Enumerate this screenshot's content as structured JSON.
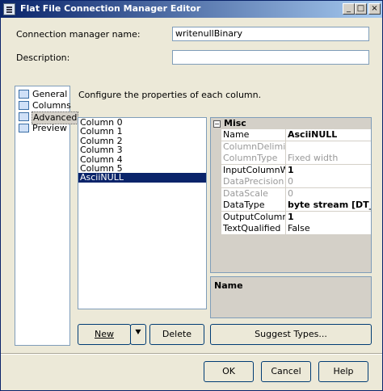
{
  "window": {
    "title": "Flat File Connection Manager Editor"
  },
  "form": {
    "name_label": "Connection manager name:",
    "name_value": "writenullBinary",
    "description_label": "Description:",
    "description_value": ""
  },
  "nav": {
    "items": [
      {
        "label": "General",
        "icon": "general-icon"
      },
      {
        "label": "Columns",
        "icon": "columns-icon"
      },
      {
        "label": "Advanced",
        "icon": "advanced-icon",
        "selected": true
      },
      {
        "label": "Preview",
        "icon": "preview-icon"
      }
    ]
  },
  "main": {
    "instruction": "Configure the properties of each column."
  },
  "columns": {
    "items": [
      "Column 0",
      "Column 1",
      "Column 2",
      "Column 3",
      "Column 4",
      "Column 5",
      "AsciiNULL"
    ],
    "selected": "AsciiNULL"
  },
  "properties": {
    "category": "Misc",
    "collapse_glyph": "−",
    "rows": [
      {
        "name": "Name",
        "value": "AsciiNULL",
        "enabled": true,
        "bold": true
      },
      {
        "name": "ColumnDelimiter",
        "value": "",
        "enabled": false
      },
      {
        "name": "ColumnType",
        "value": "Fixed width",
        "enabled": false
      },
      {
        "name": "InputColumnWidth",
        "value": "1",
        "enabled": true,
        "bold": true
      },
      {
        "name": "DataPrecision",
        "value": "0",
        "enabled": false
      },
      {
        "name": "DataScale",
        "value": "0",
        "enabled": false
      },
      {
        "name": "DataType",
        "value": "byte stream [DT_BYTES]",
        "enabled": true,
        "bold": true
      },
      {
        "name": "OutputColumnWidth",
        "value": "1",
        "enabled": true,
        "bold": true
      },
      {
        "name": "TextQualified",
        "value": "False",
        "enabled": true
      }
    ],
    "help_title": "Name"
  },
  "buttons": {
    "new": "New",
    "new_dropdown": "⯆",
    "delete": "Delete",
    "suggest": "Suggest Types...",
    "ok": "OK",
    "cancel": "Cancel",
    "help": "Help"
  },
  "titlebar_buttons": {
    "minimize": "_",
    "maximize": "□",
    "close": "×"
  }
}
